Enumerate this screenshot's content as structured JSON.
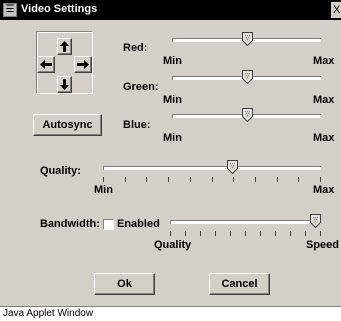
{
  "window": {
    "title": "Video Settings",
    "close_glyph": "X",
    "status_text": "Java Applet Window"
  },
  "position_pad": {
    "up_icon": "arrow-up-icon",
    "down_icon": "arrow-down-icon",
    "left_icon": "arrow-left-icon",
    "right_icon": "arrow-right-icon"
  },
  "autosync": {
    "label": "Autosync"
  },
  "color_sliders": [
    {
      "label": "Red:",
      "min_label": "Min",
      "max_label": "Max",
      "value": 0.51
    },
    {
      "label": "Green:",
      "min_label": "Min",
      "max_label": "Max",
      "value": 0.51
    },
    {
      "label": "Blue:",
      "min_label": "Min",
      "max_label": "Max",
      "value": 0.51
    }
  ],
  "quality": {
    "label": "Quality:",
    "min_label": "Min",
    "max_label": "Max",
    "value": 0.6,
    "tick_count": 11
  },
  "bandwidth": {
    "label": "Bandwidth:",
    "checkbox_label": "Enabled",
    "checked": false,
    "min_label": "Quality",
    "max_label": "Speed",
    "value": 1.0,
    "tick_count": 11
  },
  "buttons": {
    "ok": "Ok",
    "cancel": "Cancel"
  }
}
